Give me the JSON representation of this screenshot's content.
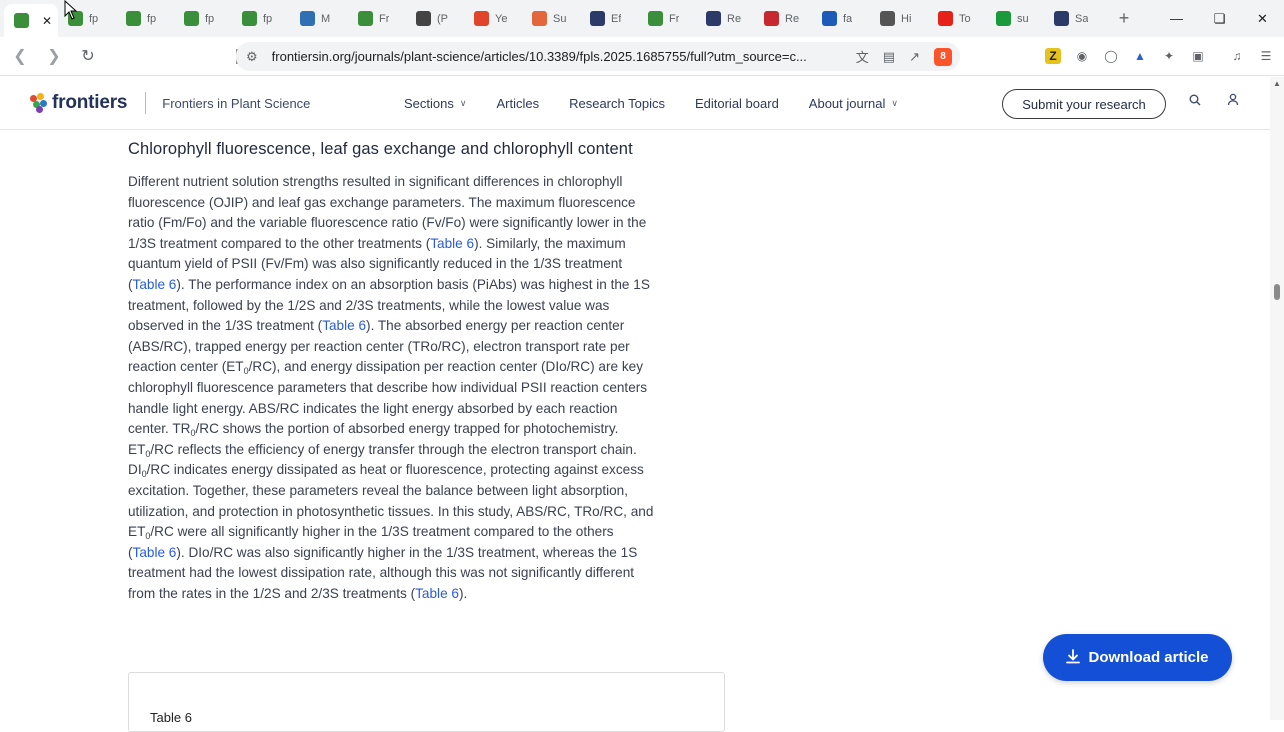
{
  "browser": {
    "tabs": [
      {
        "title": "",
        "icon": "frontiers-icon",
        "color": "#3b8f3b",
        "active": true,
        "close": "✕"
      },
      {
        "title": "fp",
        "icon": "frontiers-icon",
        "color": "#3b8f3b"
      },
      {
        "title": "fp",
        "icon": "frontiers-icon",
        "color": "#3b8f3b"
      },
      {
        "title": "fp",
        "icon": "frontiers-icon",
        "color": "#3b8f3b"
      },
      {
        "title": "fp",
        "icon": "frontiers-icon",
        "color": "#3b8f3b"
      },
      {
        "title": "M",
        "icon": "mdpi-icon",
        "color": "#2f6fb3"
      },
      {
        "title": "Fr",
        "icon": "frontiers-icon",
        "color": "#3b8f3b"
      },
      {
        "title": "(P",
        "icon": "researchgate-icon",
        "color": "#444444"
      },
      {
        "title": "Ye",
        "icon": "brave-icon",
        "color": "#e0452b"
      },
      {
        "title": "Su",
        "icon": "e-icon",
        "color": "#e2673a"
      },
      {
        "title": "Ef",
        "icon": "arrow-icon",
        "color": "#2b3a67"
      },
      {
        "title": "Fr",
        "icon": "frontiers-icon",
        "color": "#3b8f3b"
      },
      {
        "title": "Re",
        "icon": "arrow-icon",
        "color": "#2b3a67"
      },
      {
        "title": "Re",
        "icon": "heart-icon",
        "color": "#c7282f"
      },
      {
        "title": "fa",
        "icon": "cap-icon",
        "color": "#1e5bb8"
      },
      {
        "title": "Hi",
        "icon": "globe-icon",
        "color": "#555555"
      },
      {
        "title": "To",
        "icon": "youtube-icon",
        "color": "#e62117"
      },
      {
        "title": "su",
        "icon": "k-icon",
        "color": "#1a9a3a"
      },
      {
        "title": "Sa",
        "icon": "arrow-icon",
        "color": "#2b3a67"
      }
    ],
    "new_tab": "+",
    "url": "frontiersin.org/journals/plant-science/articles/10.3389/fpls.2025.1685755/full?utm_source=c...",
    "brave_count": "8"
  },
  "site": {
    "logo_text": "frontiers",
    "journal_name": "Frontiers in Plant Science",
    "nav": [
      {
        "label": "Sections",
        "dropdown": true
      },
      {
        "label": "Articles",
        "dropdown": false
      },
      {
        "label": "Research Topics",
        "dropdown": false
      },
      {
        "label": "Editorial board",
        "dropdown": false
      },
      {
        "label": "About journal",
        "dropdown": true
      }
    ],
    "submit_label": "Submit your research"
  },
  "article": {
    "heading": "Chlorophyll fluorescence, leaf gas exchange and chlorophyll content",
    "lines": [
      [
        {
          "t": "Different nutrient solution strengths resulted in significant differences in chlorophyll"
        }
      ],
      [
        {
          "t": "fluorescence (OJIP) and leaf gas exchange parameters. The maximum fluorescence"
        }
      ],
      [
        {
          "t": "ratio (Fm/Fo) and the variable fluorescence ratio (Fv/Fo) were significantly lower in the"
        }
      ],
      [
        {
          "t": "1/3S treatment compared to the other treatments ("
        },
        {
          "t": "Table 6",
          "link": true
        },
        {
          "t": "). Similarly, the maximum"
        }
      ],
      [
        {
          "t": "quantum yield of PSII (Fv/Fm) was also significantly reduced in the 1/3S treatment"
        }
      ],
      [
        {
          "t": "("
        },
        {
          "t": "Table 6",
          "link": true
        },
        {
          "t": "). The performance index on an absorption basis (PiAbs) was highest in the 1S"
        }
      ],
      [
        {
          "t": "treatment, followed by the 1/2S and 2/3S treatments, while the lowest value was"
        }
      ],
      [
        {
          "t": "observed in the 1/3S treatment ("
        },
        {
          "t": "Table 6",
          "link": true
        },
        {
          "t": "). The absorbed energy per reaction center"
        }
      ],
      [
        {
          "t": "(ABS/RC), trapped energy per reaction center (TRo/RC), electron transport rate per"
        }
      ],
      [
        {
          "t": "reaction center (ET"
        },
        {
          "t": "0",
          "sub": true
        },
        {
          "t": "/RC), and energy dissipation per reaction center (DIo/RC) are key"
        }
      ],
      [
        {
          "t": "chlorophyll fluorescence parameters that describe how individual PSII reaction centers"
        }
      ],
      [
        {
          "t": "handle light energy. ABS/RC indicates the light energy absorbed by each reaction"
        }
      ],
      [
        {
          "t": "center. TR"
        },
        {
          "t": "0",
          "sub": true
        },
        {
          "t": "/RC shows the portion of absorbed energy trapped for photochemistry."
        }
      ],
      [
        {
          "t": "ET"
        },
        {
          "t": "0",
          "sub": true
        },
        {
          "t": "/RC reflects the efficiency of energy transfer through the electron transport chain."
        }
      ],
      [
        {
          "t": "DI"
        },
        {
          "t": "0",
          "sub": true
        },
        {
          "t": "/RC indicates energy dissipated as heat or fluorescence, protecting against excess"
        }
      ],
      [
        {
          "t": "excitation. Together, these parameters reveal the balance between light absorption,"
        }
      ],
      [
        {
          "t": "utilization, and protection in photosynthetic tissues. In this study, ABS/RC, TRo/RC, and"
        }
      ],
      [
        {
          "t": "ET"
        },
        {
          "t": "0",
          "sub": true
        },
        {
          "t": "/RC were all significantly higher in the 1/3S treatment compared to the others"
        }
      ],
      [
        {
          "t": "("
        },
        {
          "t": "Table 6",
          "link": true
        },
        {
          "t": "). DIo/RC was also significantly higher in the 1/3S treatment, whereas the 1S"
        }
      ],
      [
        {
          "t": "treatment had the lowest dissipation rate, although this was not significantly different"
        }
      ],
      [
        {
          "t": "from the rates in the 1/2S and 2/3S treatments ("
        },
        {
          "t": "Table 6",
          "link": true
        },
        {
          "t": ")."
        }
      ]
    ],
    "table_label": "Table 6"
  },
  "download_label": "Download article",
  "colors": {
    "link": "#2a5bd7",
    "download_button": "#1450d6",
    "logo_text": "#24325a"
  }
}
